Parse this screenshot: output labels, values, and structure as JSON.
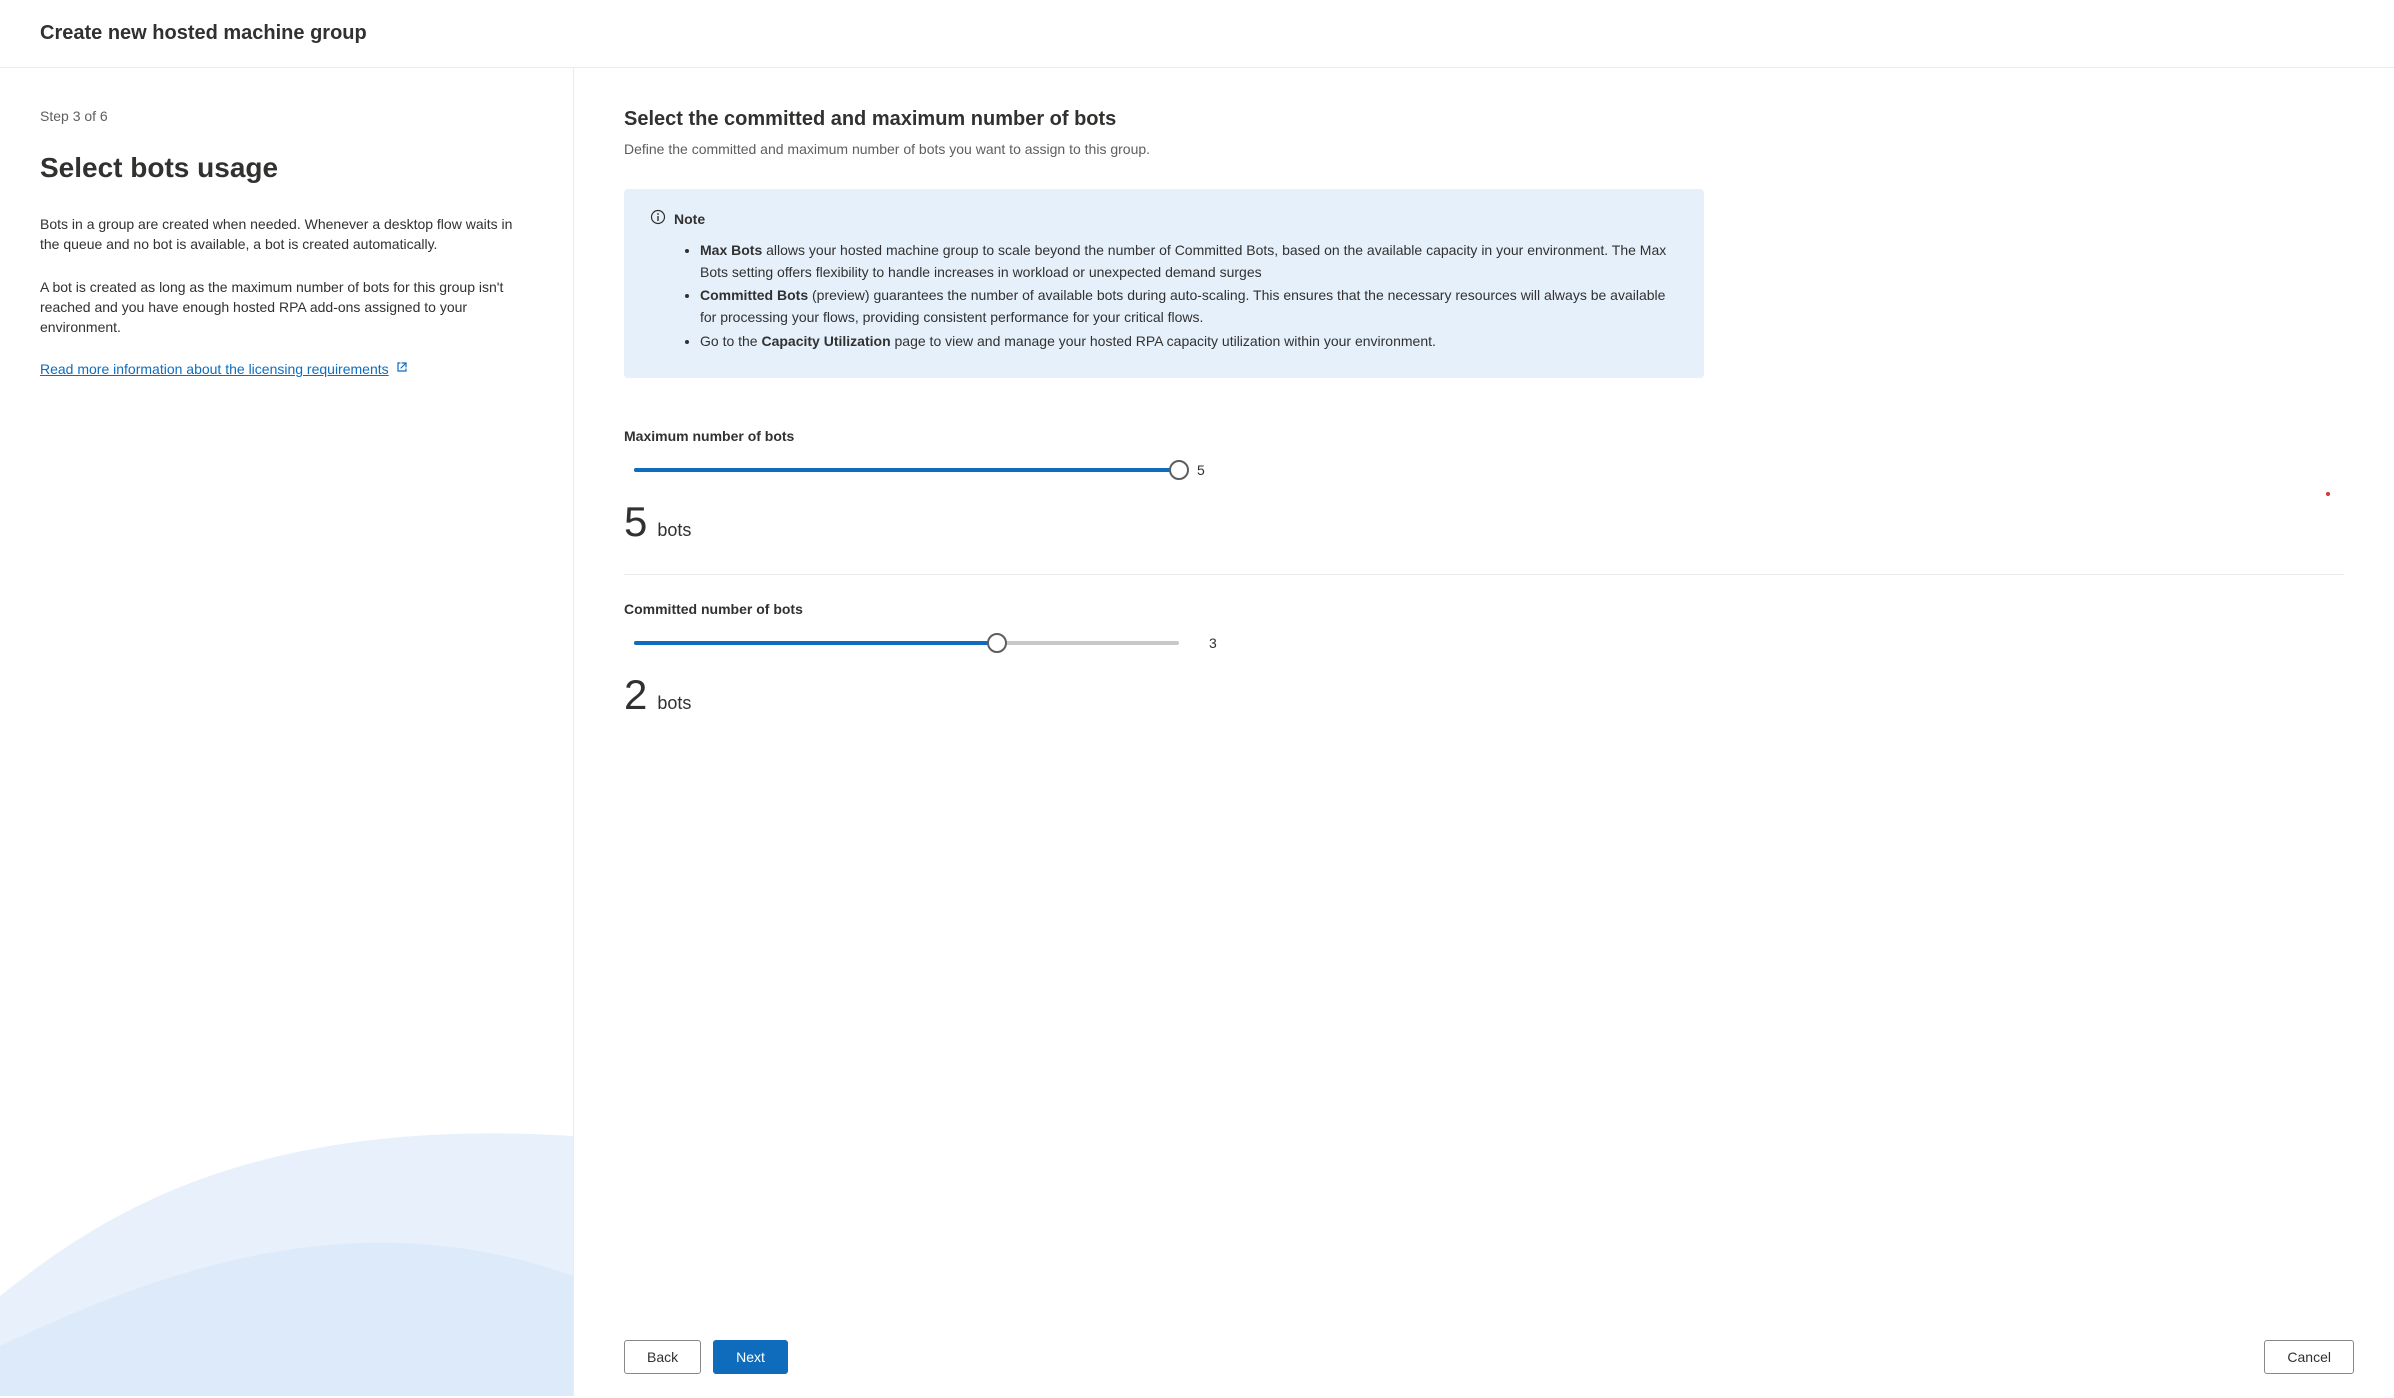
{
  "header": {
    "title": "Create new hosted machine group"
  },
  "sidebar": {
    "step_label": "Step 3 of 6",
    "heading": "Select bots usage",
    "para1": "Bots in a group are created when needed. Whenever a desktop flow waits in the queue and no bot is available, a bot is created automatically.",
    "para2": "A bot is created as long as the maximum number of bots for this group isn't reached and you have enough hosted RPA add-ons assigned to your environment.",
    "link_text": "Read more information about the licensing requirements"
  },
  "main": {
    "title": "Select the committed and maximum number of bots",
    "subtitle": "Define the committed and maximum number of bots you want to assign to this group.",
    "note": {
      "label": "Note",
      "bullet1_strong": "Max Bots",
      "bullet1_rest": " allows your hosted machine group to scale beyond the number of Committed Bots, based on the available capacity in your environment. The Max Bots setting offers flexibility to handle increases in workload or unexpected demand surges",
      "bullet2_strong": "Committed Bots",
      "bullet2_rest": " (preview) guarantees the number of available bots during auto-scaling. This ensures that the necessary resources will always be available for processing your flows, providing consistent performance for your critical flows.",
      "bullet3_prefix": "Go to the ",
      "bullet3_strong": "Capacity Utilization",
      "bullet3_rest": " page to view and manage your hosted RPA capacity utilization within your environment."
    },
    "max_section": {
      "label": "Maximum number of bots",
      "value": 5,
      "max": 5,
      "tick_label": "5",
      "display_number": "5",
      "unit": "bots"
    },
    "committed_section": {
      "label": "Committed number of bots",
      "value": 2,
      "max": 3,
      "tick_label": "3",
      "display_number": "2",
      "unit": "bots"
    }
  },
  "footer": {
    "back": "Back",
    "next": "Next",
    "cancel": "Cancel"
  }
}
